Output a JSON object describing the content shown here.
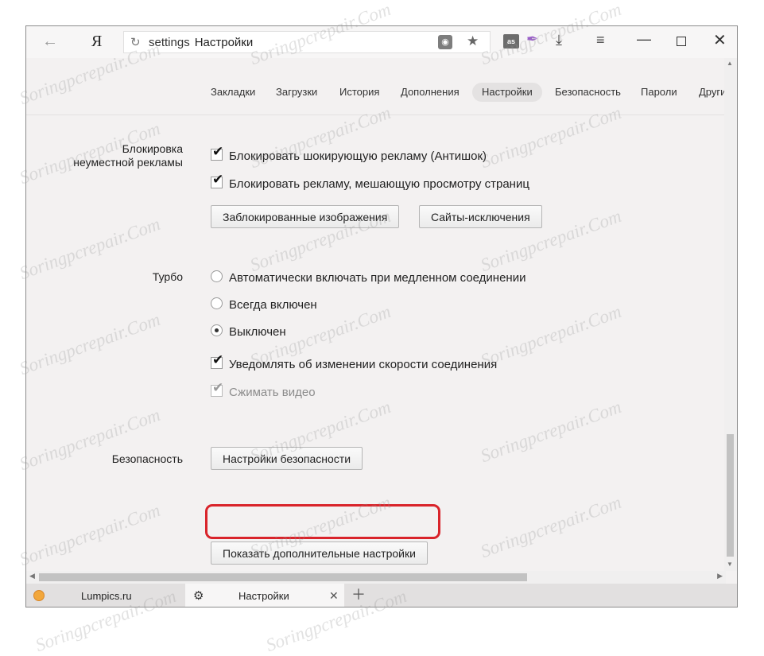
{
  "browser": {
    "logo": "Я",
    "address": {
      "scheme": "settings",
      "title": "Настройки"
    },
    "lastfm_icon": "as",
    "icons": [
      "back-arrow-icon",
      "reload-icon",
      "shield-icon",
      "star-icon",
      "lastfm-icon",
      "pen-icon",
      "download-icon",
      "menu-icon",
      "minimize-icon",
      "maximize-icon",
      "close-icon"
    ]
  },
  "settings_nav": {
    "items": [
      {
        "label": "Закладки"
      },
      {
        "label": "Загрузки"
      },
      {
        "label": "История"
      },
      {
        "label": "Дополнения"
      },
      {
        "label": "Настройки",
        "active": true
      },
      {
        "label": "Безопасность"
      },
      {
        "label": "Пароли"
      },
      {
        "label": "Други"
      }
    ]
  },
  "ads": {
    "label_line1": "Блокировка",
    "label_line2": "неуместной рекламы",
    "opt1": {
      "label": "Блокировать шокирующую рекламу (Антишок)",
      "checked": true
    },
    "opt2": {
      "label": "Блокировать рекламу, мешающую просмотру страниц",
      "checked": true
    },
    "btn_blocked_images": "Заблокированные изображения",
    "btn_exceptions": "Сайты-исключения"
  },
  "turbo": {
    "label": "Турбо",
    "radio1": "Автоматически включать при медленном соединении",
    "radio2": "Всегда включен",
    "radio3": "Выключен",
    "selected": "Выключен",
    "cb_notify": {
      "label": "Уведомлять об изменении скорости соединения",
      "checked": true
    },
    "cb_compress": {
      "label": "Сжимать видео",
      "checked": true,
      "disabled": true
    }
  },
  "security": {
    "label": "Безопасность",
    "btn": "Настройки безопасности"
  },
  "show_more_button": "Показать дополнительные настройки",
  "tabs": [
    {
      "title": "Lumpics.ru",
      "active": false
    },
    {
      "title": "Настройки",
      "active": true
    }
  ],
  "watermark": "Soringpcrepair.Com",
  "colors": {
    "highlight": "#d9242b",
    "background": "#f3f1f1"
  }
}
